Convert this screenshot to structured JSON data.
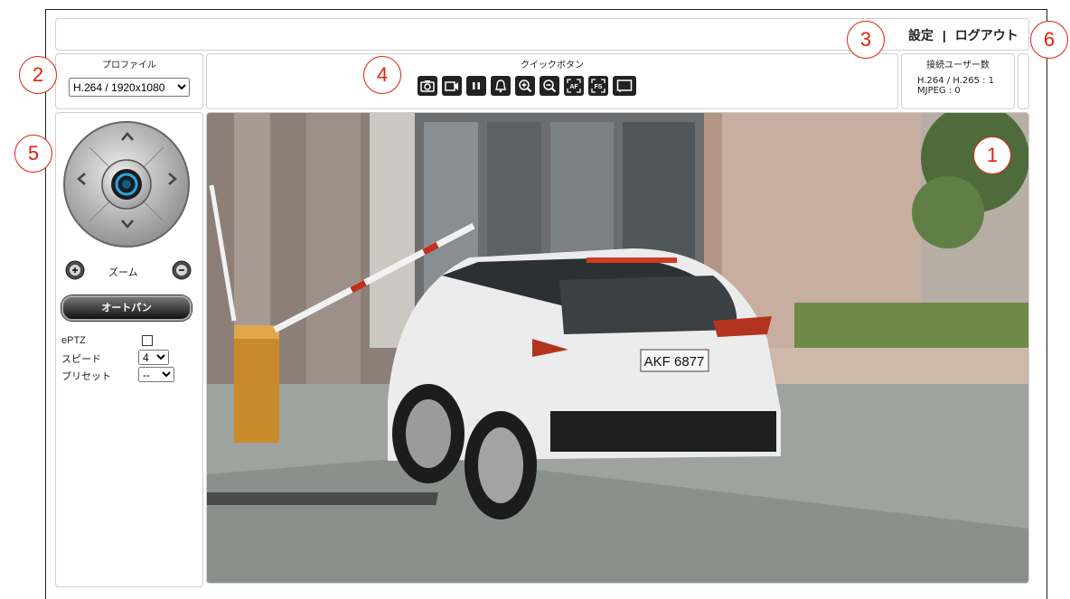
{
  "header": {
    "settings_label": "設定",
    "separator": "|",
    "logout_label": "ログアウト"
  },
  "profile": {
    "title": "プロファイル",
    "selected": "H.264 / 1920x1080"
  },
  "quick_buttons": {
    "title": "クイックボタン",
    "icons": [
      "snapshot-icon",
      "record-icon",
      "pause-icon",
      "alarm-bell-icon",
      "zoom-in-icon",
      "zoom-out-icon",
      "autofocus-icon",
      "fullscreen-icon",
      "display-icon"
    ],
    "af_text": "AF",
    "fs_text": "FS"
  },
  "connections": {
    "title": "接続ユーザー数",
    "line1": "H.264 / H.265 : 1",
    "line2": "MJPEG : 0"
  },
  "ptz": {
    "zoom_label": "ズーム",
    "autopan_label": "オートパン",
    "eptz_label": "ePTZ",
    "speed_label": "スピード",
    "speed_value": "4",
    "preset_label": "プリセット",
    "preset_value": "--"
  },
  "video": {
    "plate_text": "AKF 6877"
  },
  "callouts": [
    "1",
    "2",
    "3",
    "4",
    "5",
    "6"
  ],
  "colors": {
    "callout": "#e02010",
    "panel_border": "#cfcfcf"
  }
}
